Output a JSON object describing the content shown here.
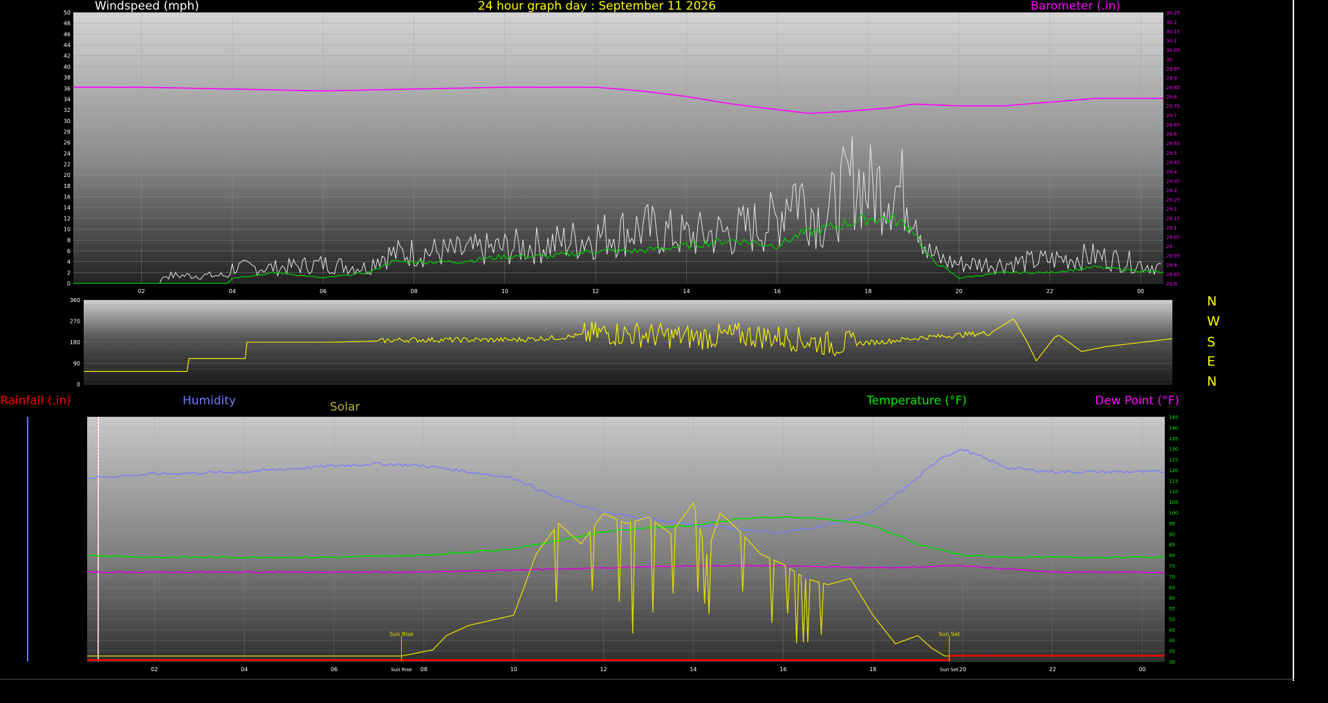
{
  "header": {
    "windspeed_label": "Windspeed (mph)",
    "title": "24 hour graph day : September 11 2026",
    "barometer_label": "Barometer (.in)"
  },
  "compass": [
    "N",
    "W",
    "S",
    "E",
    "N"
  ],
  "lower_labels": {
    "rainfall": "Rainfall (.in)",
    "humidity": "Humidity",
    "solar": "Solar",
    "temperature": "Temperature (°F)",
    "dew_point": "Dew Point (°F)"
  },
  "annotations": {
    "sun_rise": "Sun Rise",
    "sun_set": "Sun Set"
  },
  "colors": {
    "windspeed_gust": "#e8e8e8",
    "windspeed_avg": "#00cc00",
    "barometer": "#ff00ff",
    "direction": "#ffff00",
    "humidity": "#7777ff",
    "solar": "#e0e000",
    "temperature": "#00dd00",
    "dew_point": "#dd00dd",
    "rainfall": "#ff0000",
    "title": "#ffff00"
  },
  "chart_data": [
    {
      "type": "line",
      "name": "wind_barometer",
      "x_ticks": [
        "02",
        "04",
        "06",
        "08",
        "10",
        "12",
        "14",
        "16",
        "18",
        "20",
        "22",
        "00"
      ],
      "x_range_hours": [
        0.5,
        24.5
      ],
      "y_left": {
        "label": "Windspeed (mph)",
        "range": [
          0,
          50
        ],
        "ticks": [
          "0",
          "2",
          "4",
          "6",
          "8",
          "10",
          "12",
          "14",
          "16",
          "18",
          "20",
          "22",
          "24",
          "26",
          "28",
          "30",
          "32",
          "34",
          "36",
          "38",
          "40",
          "42",
          "44",
          "46",
          "48",
          "50"
        ]
      },
      "y_right": {
        "label": "Barometer (.in)",
        "range": [
          28.8,
          30.25
        ],
        "ticks": [
          "29.8",
          "29.85",
          "29.9",
          "29.95",
          "29",
          "29.05",
          "29.1",
          "29.15",
          "29.2",
          "29.25",
          "29.3",
          "29.35",
          "29.4",
          "29.45",
          "29.5",
          "29.55",
          "29.6",
          "29.65",
          "29.7",
          "29.75",
          "29.8",
          "29.85",
          "29.9",
          "29.95",
          "30",
          "30.05",
          "30.1",
          "30.15",
          "30.2",
          "30.25"
        ]
      },
      "series": [
        {
          "name": "Barometer",
          "x": [
            0.5,
            2,
            4,
            6,
            8,
            10,
            12,
            13,
            14,
            15,
            16,
            16.7,
            17.5,
            18.5,
            19,
            20,
            21,
            22,
            23,
            24.5
          ],
          "y": [
            29.85,
            29.85,
            29.84,
            29.83,
            29.84,
            29.85,
            29.85,
            29.83,
            29.8,
            29.76,
            29.73,
            29.71,
            29.72,
            29.74,
            29.76,
            29.75,
            29.75,
            29.77,
            29.79,
            29.79
          ]
        },
        {
          "name": "Gust",
          "x": [
            0.5,
            2.4,
            2.5,
            3.9,
            4,
            5,
            6,
            7,
            7.2,
            8,
            9,
            10,
            11,
            12,
            13,
            14,
            15,
            16,
            16.3,
            17,
            17.7,
            18,
            18.5,
            19,
            19.3,
            19.6,
            20,
            21,
            22,
            23,
            24.5
          ],
          "y": [
            0,
            0,
            2,
            2,
            4,
            4,
            5,
            4,
            7,
            8,
            8,
            9,
            10,
            12,
            14,
            12,
            13,
            16,
            25,
            16,
            27,
            24,
            25,
            22,
            8,
            6,
            5,
            5,
            6,
            7,
            4
          ]
        },
        {
          "name": "Average",
          "x": [
            0.5,
            3.9,
            4,
            5,
            6,
            7,
            7.5,
            8,
            9,
            10,
            11,
            12,
            13,
            14,
            15,
            16,
            16.5,
            17,
            18,
            18.5,
            19,
            19.3,
            20,
            21,
            22,
            23,
            24.5
          ],
          "y": [
            0,
            0,
            1,
            2,
            1,
            2,
            4,
            4,
            4,
            5,
            5,
            6,
            6,
            7,
            8,
            7,
            9,
            10,
            12,
            12,
            10,
            5,
            1,
            2,
            2,
            3,
            2
          ]
        }
      ]
    },
    {
      "type": "line",
      "name": "wind_direction",
      "y_range": [
        0,
        360
      ],
      "y_ticks": [
        "0",
        "90",
        "180",
        "270",
        "360"
      ],
      "series": [
        {
          "name": "Direction",
          "x": [
            0.5,
            2.8,
            2.8,
            4.1,
            4.1,
            6,
            7,
            7.5,
            8,
            10,
            11,
            12,
            13,
            14,
            15,
            16,
            17,
            18,
            19,
            20.5,
            21,
            21.3,
            21.5,
            21.9,
            22,
            22.5,
            23,
            24.5
          ],
          "y": [
            55,
            55,
            110,
            110,
            180,
            180,
            185,
            190,
            190,
            190,
            200,
            220,
            210,
            200,
            210,
            200,
            170,
            180,
            200,
            220,
            280,
            180,
            100,
            200,
            210,
            140,
            160,
            195
          ]
        }
      ]
    },
    {
      "type": "line",
      "name": "climate",
      "x_ticks": [
        "02",
        "04",
        "06",
        "08",
        "10",
        "12",
        "14",
        "16",
        "18",
        "20",
        "22",
        "00"
      ],
      "temperature_axis": {
        "range": [
          30,
          145
        ],
        "ticks": [
          "30",
          "35",
          "40",
          "45",
          "50",
          "55",
          "60",
          "65",
          "70",
          "75",
          "80",
          "85",
          "90",
          "95",
          "100",
          "105",
          "110",
          "115",
          "120",
          "125",
          "130",
          "135",
          "140",
          "145"
        ]
      },
      "rainfall_axis": {
        "range": [
          0,
          1.1
        ]
      },
      "humidity_axis_range": [
        0,
        120
      ],
      "solar_axis_range": [
        0,
        1200
      ],
      "series": [
        {
          "name": "Humidity",
          "x": [
            0.5,
            2,
            4,
            6,
            7,
            8,
            10,
            11,
            12,
            13,
            14,
            15,
            16,
            17,
            18,
            19,
            19.5,
            20,
            21,
            22,
            23,
            24.5
          ],
          "y": [
            90,
            92,
            93,
            96,
            97,
            96,
            90,
            80,
            73,
            70,
            67,
            65,
            63,
            67,
            73,
            90,
            100,
            104,
            95,
            93,
            93,
            93
          ]
        },
        {
          "name": "Temperature",
          "x": [
            0.5,
            2,
            4,
            6,
            8,
            10,
            11,
            12,
            13,
            14,
            15,
            16,
            17,
            18,
            19,
            20,
            21,
            22,
            23,
            24.5
          ],
          "y": [
            80,
            79,
            79,
            79,
            80,
            83,
            87,
            91,
            93,
            94,
            97,
            98,
            97,
            94,
            85,
            80,
            79,
            79,
            79,
            79
          ]
        },
        {
          "name": "Dew Point",
          "x": [
            0.5,
            4,
            8,
            12,
            14,
            16,
            18,
            20,
            22,
            24.5
          ],
          "y": [
            72,
            72,
            72,
            74,
            75,
            75,
            74,
            75,
            72,
            72
          ]
        },
        {
          "name": "Solar",
          "x": [
            0.5,
            7.5,
            8.2,
            8.5,
            9,
            10,
            10.5,
            11,
            11.5,
            12,
            12.5,
            13,
            13.5,
            14,
            14.3,
            14.6,
            15,
            15.5,
            16,
            16.5,
            17,
            17.5,
            18,
            18.5,
            19,
            19.3,
            19.6,
            20
          ],
          "y": [
            0,
            0,
            30,
            100,
            150,
            200,
            500,
            650,
            550,
            700,
            650,
            680,
            600,
            750,
            500,
            700,
            620,
            500,
            450,
            380,
            350,
            380,
            200,
            60,
            100,
            40,
            0,
            0
          ]
        },
        {
          "name": "Rainfall",
          "x": [
            0.5,
            19.7,
            19.7,
            24.5
          ],
          "y": [
            0,
            0,
            0.02,
            0.02
          ]
        }
      ]
    }
  ]
}
